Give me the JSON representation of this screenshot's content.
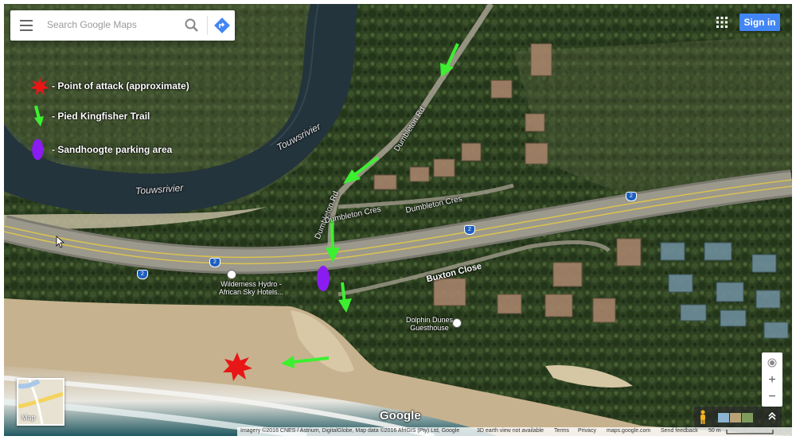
{
  "search": {
    "placeholder": "Search Google Maps"
  },
  "header": {
    "signin_label": "Sign in"
  },
  "legend": [
    {
      "icon": "red-star-icon",
      "label": "- Point of attack (approximate)",
      "color": "#e81616"
    },
    {
      "icon": "green-arrow-icon",
      "label": "- Pied Kingfisher Trail",
      "color": "#3cf030"
    },
    {
      "icon": "purple-oval-icon",
      "label": "- Sandhoogte parking area",
      "color": "#8a1cf2"
    }
  ],
  "map_labels": {
    "river_1": "Touwsrivier",
    "river_2": "Touwsrivier",
    "road_dumbleton_1": "Dumbleton Rd",
    "road_dumbleton_2": "Dumbleton Rd",
    "road_dumbleton_cres_1": "Dumbleton Cres",
    "road_dumbleton_cres_2": "Dumbleton Cres",
    "road_buxton": "Buxton Close",
    "route_shield": "2",
    "poi_wilderness_line1": "Wilderness Hydro -",
    "poi_wilderness_line2": "African Sky Hotels...",
    "poi_dolphin_line1": "Dolphin Dunes",
    "poi_dolphin_line2": "Guesthouse"
  },
  "minimap": {
    "label": "Map"
  },
  "brand": {
    "logo_text": "Google"
  },
  "controls": {
    "zoom_in": "+",
    "zoom_out": "−"
  },
  "footer": {
    "imagery": "Imagery ©2016 CNES / Astrium, DigitalGlobe, Map data ©2016 AfriGIS (Pty) Ltd, Google",
    "earth_view": "3D earth view not available",
    "terms": "Terms",
    "privacy": "Privacy",
    "site": "maps.google.com",
    "feedback": "Send feedback",
    "scale": "50 m"
  },
  "colors": {
    "trail_arrow": "#3cf030",
    "attack_star": "#e81616",
    "parking": "#8a1cf2",
    "signin_button": "#4285f4"
  }
}
